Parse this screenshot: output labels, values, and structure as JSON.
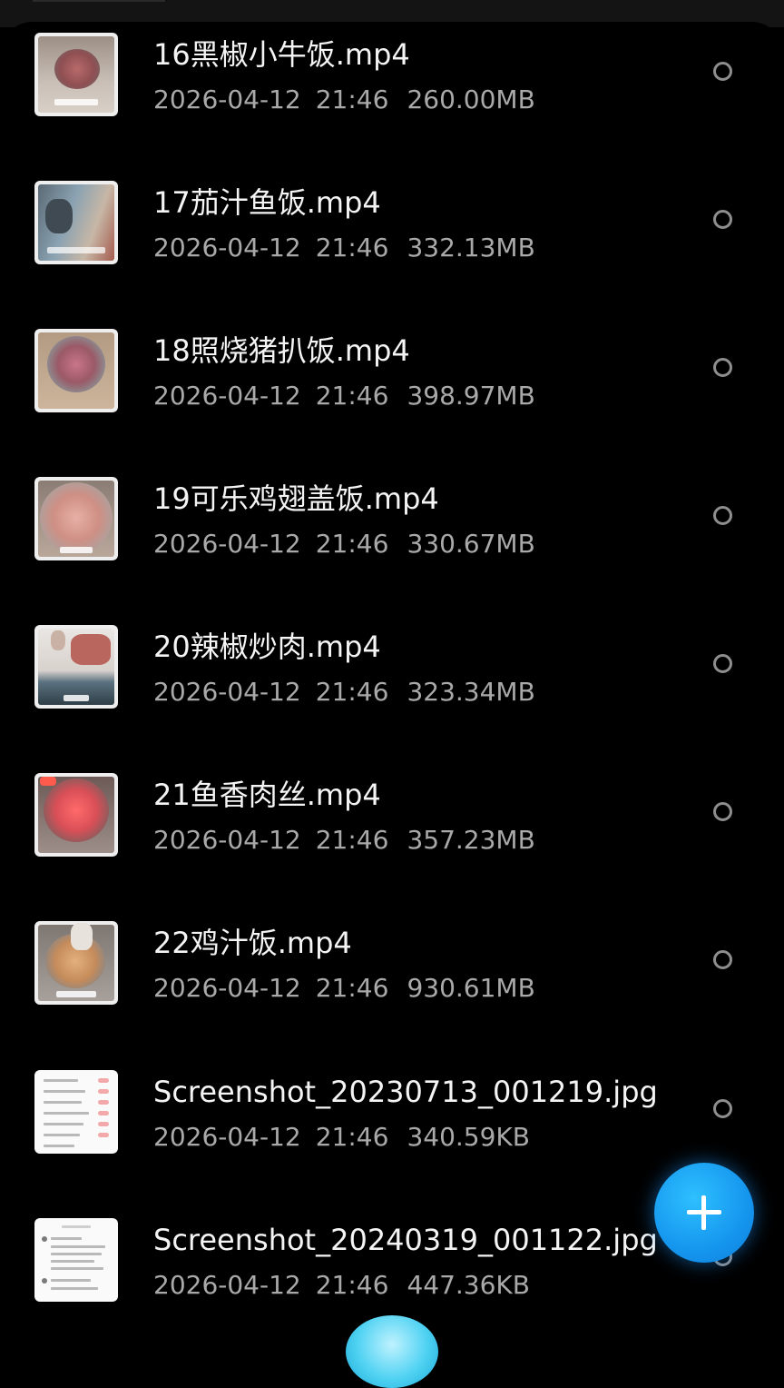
{
  "colors": {
    "background": "#000000",
    "filename_text": "#f4f4f4",
    "meta_text": "#a9a9a9",
    "radio_ring": "#8e8e8e",
    "fab": "#1596ee"
  },
  "files": [
    {
      "name": "16黑椒小牛饭.mp4",
      "date": "2026-04-12",
      "time": "21:46",
      "size": "260.00MB",
      "thumb_icon": "video-thumbnail"
    },
    {
      "name": "17茄汁鱼饭.mp4",
      "date": "2026-04-12",
      "time": "21:46",
      "size": "332.13MB",
      "thumb_icon": "video-thumbnail"
    },
    {
      "name": "18照烧猪扒饭.mp4",
      "date": "2026-04-12",
      "time": "21:46",
      "size": "398.97MB",
      "thumb_icon": "video-thumbnail"
    },
    {
      "name": "19可乐鸡翅盖饭.mp4",
      "date": "2026-04-12",
      "time": "21:46",
      "size": "330.67MB",
      "thumb_icon": "video-thumbnail"
    },
    {
      "name": "20辣椒炒肉.mp4",
      "date": "2026-04-12",
      "time": "21:46",
      "size": "323.34MB",
      "thumb_icon": "video-thumbnail"
    },
    {
      "name": "21鱼香肉丝.mp4",
      "date": "2026-04-12",
      "time": "21:46",
      "size": "357.23MB",
      "thumb_icon": "video-thumbnail"
    },
    {
      "name": "22鸡汁饭.mp4",
      "date": "2026-04-12",
      "time": "21:46",
      "size": "930.61MB",
      "thumb_icon": "video-thumbnail"
    },
    {
      "name": "Screenshot_20230713_001219.jpg",
      "date": "2026-04-12",
      "time": "21:46",
      "size": "340.59KB",
      "thumb_icon": "image-thumbnail"
    },
    {
      "name": "Screenshot_20240319_001122.jpg",
      "date": "2026-04-12",
      "time": "21:46",
      "size": "447.36KB",
      "thumb_icon": "image-thumbnail"
    }
  ],
  "fab": {
    "icon": "plus-icon"
  }
}
